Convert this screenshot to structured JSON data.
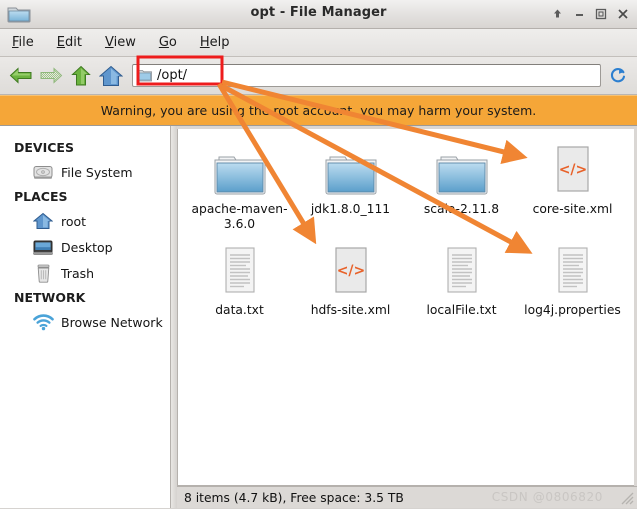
{
  "window": {
    "title": "opt - File Manager",
    "icon": "folder-icon",
    "buttons": [
      {
        "name": "shade-button",
        "glyph": "up-arrow-icon"
      },
      {
        "name": "minimize-button",
        "glyph": "minimize-icon"
      },
      {
        "name": "maximize-button",
        "glyph": "maximize-icon"
      },
      {
        "name": "close-button",
        "glyph": "close-icon"
      }
    ]
  },
  "menubar": {
    "items": [
      {
        "label": "File",
        "mnemonic": "F",
        "rest": "ile"
      },
      {
        "label": "Edit",
        "mnemonic": "E",
        "rest": "dit"
      },
      {
        "label": "View",
        "mnemonic": "V",
        "rest": "iew"
      },
      {
        "label": "Go",
        "mnemonic": "G",
        "rest": "o"
      },
      {
        "label": "Help",
        "mnemonic": "H",
        "rest": "elp"
      }
    ]
  },
  "toolbar": {
    "back": "Back",
    "forward": "Forward",
    "up": "Up",
    "home": "Home",
    "reload": "Reload",
    "path_value": "/opt/",
    "path_placeholder": "/opt/"
  },
  "warning": {
    "text": "Warning, you are using the root account, you may harm your system.",
    "color": "#f5a638"
  },
  "sidebar": {
    "sections": [
      {
        "heading": "DEVICES",
        "items": [
          {
            "label": "File System",
            "icon": "harddisk-icon"
          }
        ]
      },
      {
        "heading": "PLACES",
        "items": [
          {
            "label": "root",
            "icon": "home-icon"
          },
          {
            "label": "Desktop",
            "icon": "desktop-icon"
          },
          {
            "label": "Trash",
            "icon": "trash-icon"
          }
        ]
      },
      {
        "heading": "NETWORK",
        "items": [
          {
            "label": "Browse Network",
            "icon": "network-icon"
          }
        ]
      }
    ]
  },
  "files": [
    {
      "name": "apache-maven-3.6.0",
      "type": "folder"
    },
    {
      "name": "jdk1.8.0_111",
      "type": "folder"
    },
    {
      "name": "scala-2.11.8",
      "type": "folder"
    },
    {
      "name": "core-site.xml",
      "type": "xml"
    },
    {
      "name": "data.txt",
      "type": "text"
    },
    {
      "name": "hdfs-site.xml",
      "type": "xml"
    },
    {
      "name": "localFile.txt",
      "type": "text"
    },
    {
      "name": "log4j.properties",
      "type": "text"
    }
  ],
  "statusbar": {
    "text": "8 items (4.7 kB), Free space: 3.5 TB",
    "watermark": "CSDN @0806820"
  },
  "annotations": {
    "highlight_color": "#ee1c1c",
    "arrow_color": "#f08533",
    "targets": [
      "core-site.xml",
      "hdfs-site.xml",
      "log4j.properties"
    ]
  }
}
